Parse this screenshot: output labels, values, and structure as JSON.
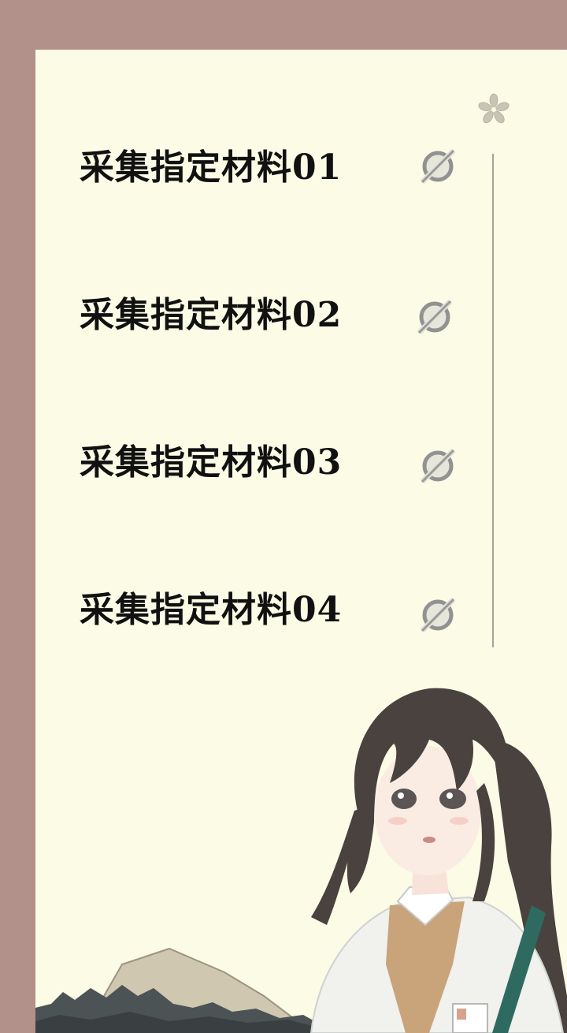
{
  "tasks": [
    {
      "label": "采集指定材料01",
      "status_icon": "empty-circle-slash-icon",
      "completed": false
    },
    {
      "label": "采集指定材料02",
      "status_icon": "empty-circle-slash-icon",
      "completed": false
    },
    {
      "label": "采集指定材料03",
      "status_icon": "empty-circle-slash-icon",
      "completed": false
    },
    {
      "label": "采集指定材料04",
      "status_icon": "empty-circle-slash-icon",
      "completed": false
    }
  ],
  "decor": {
    "corner_icon": "sakura-flower-icon"
  },
  "colors": {
    "page_frame": "#b2918b",
    "panel": "#fbfbe6",
    "label": "#111111",
    "icon": "#8f8f8f",
    "divider": "#a6a49a"
  }
}
